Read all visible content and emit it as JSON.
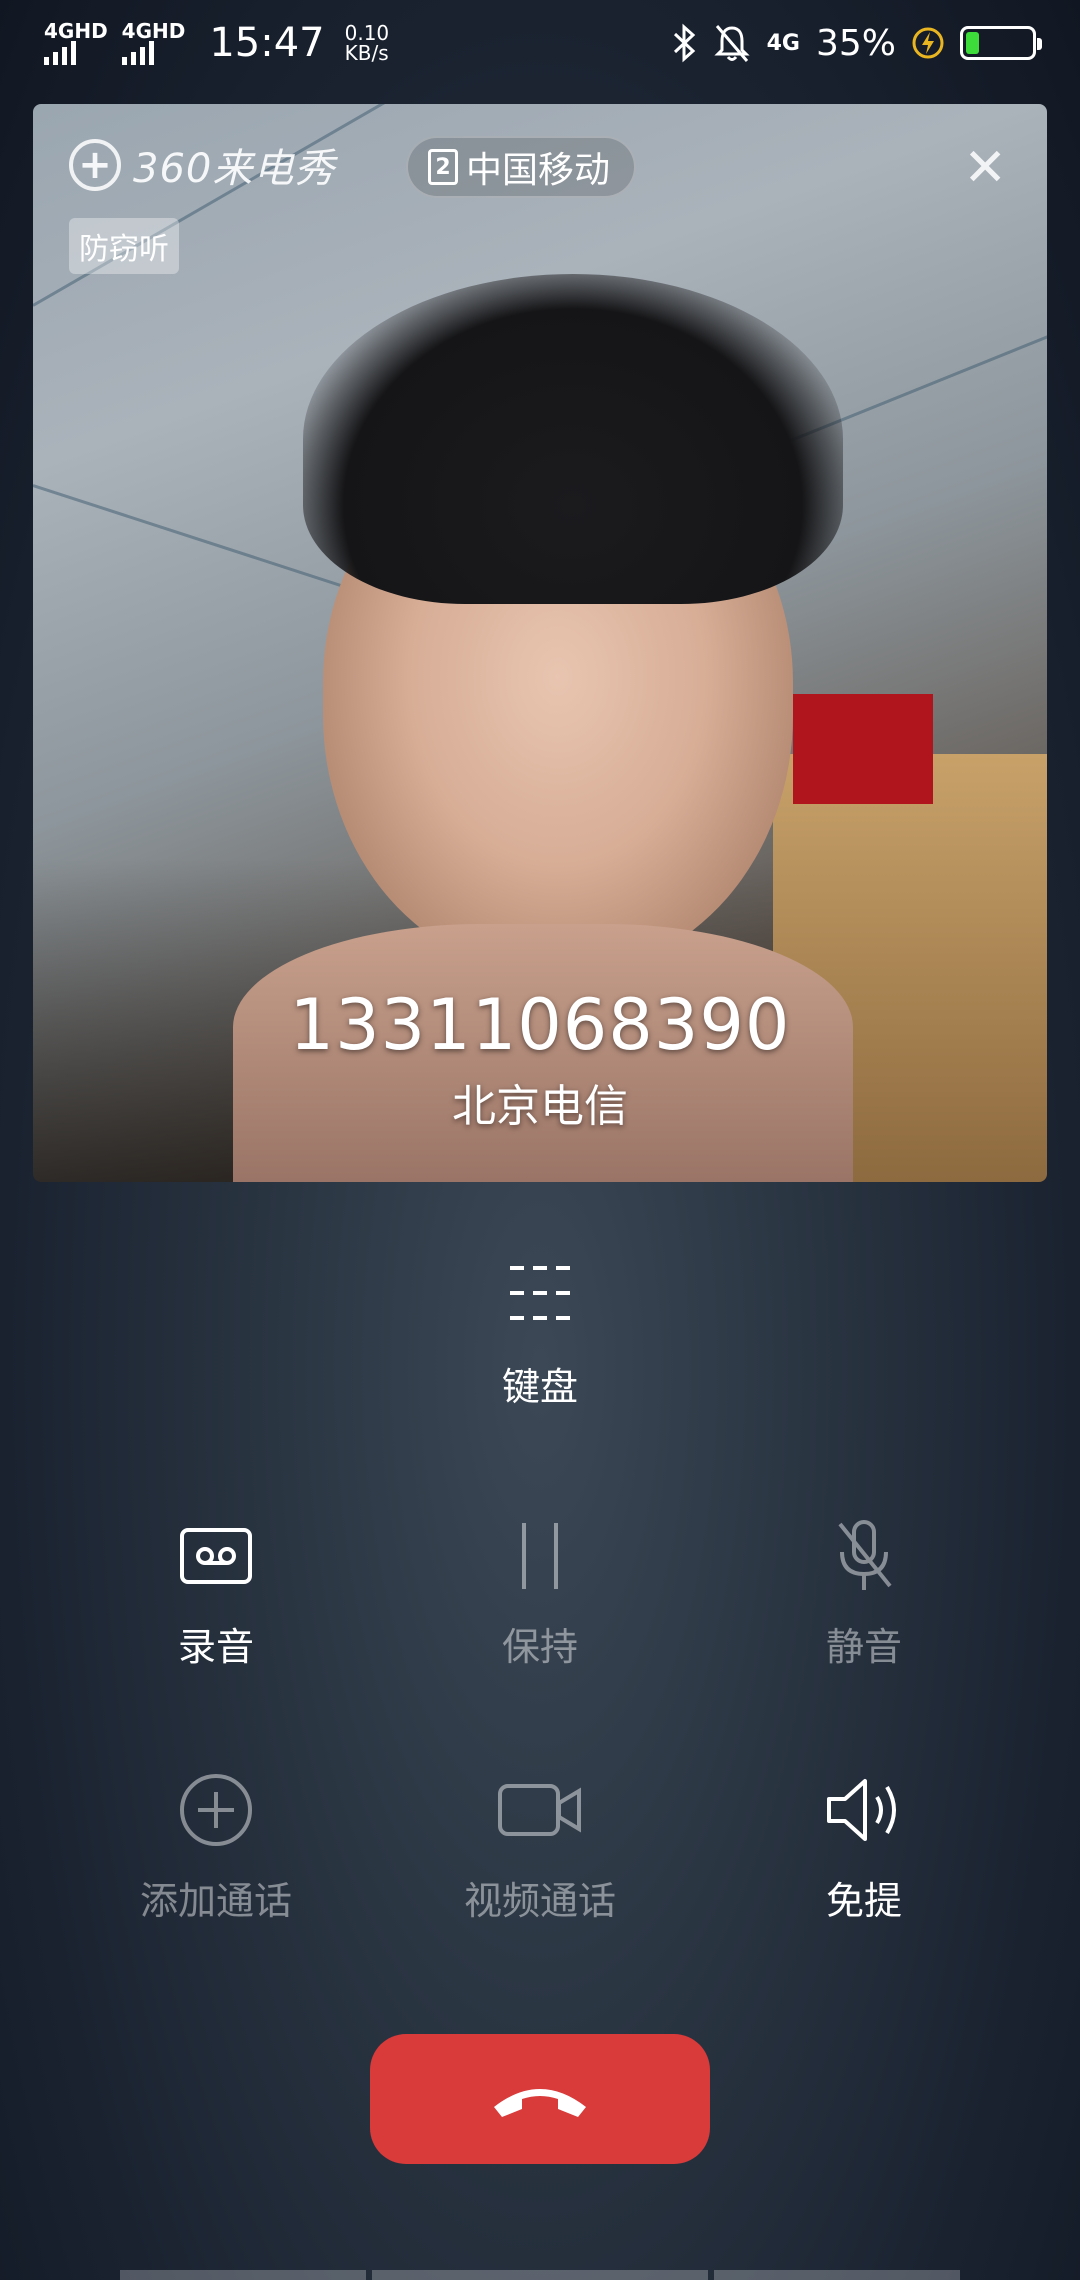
{
  "status_bar": {
    "sim1_label": "4GHD",
    "sim2_label": "4GHD",
    "time": "15:47",
    "speed_value": "0.10",
    "speed_unit": "KB/s",
    "net_label": "4G",
    "battery_percent": "35%",
    "battery_level": 0.2,
    "icons": [
      "bluetooth-icon",
      "mute-bell-icon",
      "charging-icon"
    ]
  },
  "card": {
    "brand_name": "360来电秀",
    "carrier_sim": "2",
    "carrier_name": "中国移动",
    "anti_tag": "防窃听",
    "phone_number": "13311068390",
    "location": "北京电信"
  },
  "keypad": {
    "label": "键盘"
  },
  "controls": {
    "record": {
      "label": "录音",
      "enabled": true
    },
    "hold": {
      "label": "保持",
      "enabled": false
    },
    "mute": {
      "label": "静音",
      "enabled": false
    },
    "add_call": {
      "label": "添加通话",
      "enabled": false
    },
    "video_call": {
      "label": "视频通话",
      "enabled": false
    },
    "speaker": {
      "label": "免提",
      "enabled": true
    }
  },
  "colors": {
    "hangup": "#d93a3a",
    "battery": "#3ddc3a"
  }
}
